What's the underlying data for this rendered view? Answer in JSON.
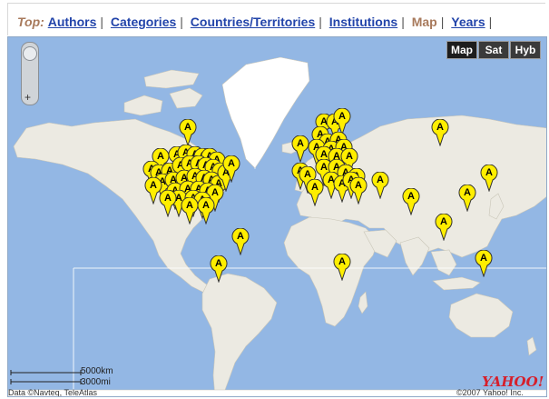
{
  "nav": {
    "heading": "Top:",
    "links": [
      {
        "label": "Authors",
        "current": false
      },
      {
        "label": "Categories",
        "current": false
      },
      {
        "label": "Countries/Territories",
        "current": false
      },
      {
        "label": "Institutions",
        "current": false
      },
      {
        "label": "Map",
        "current": true
      },
      {
        "label": "Years",
        "current": false
      }
    ],
    "separator": "|"
  },
  "map": {
    "map_types": [
      "Map",
      "Sat",
      "Hyb"
    ],
    "active_map_type": "Map",
    "zoom_minus": "−",
    "zoom_plus": "+",
    "marker_letter": "A",
    "marker_count": 72,
    "scale": {
      "km": "5000km",
      "mi": "3000mi"
    },
    "attribution": "Data ©Navteq, TeleAtlas",
    "copyright": "©2007 Yahoo! Inc.",
    "logo_text": "YAHOO!",
    "colors": {
      "water": "#93b7e4",
      "land": "#eceae2",
      "ice": "#ffffff",
      "marker": "#ffee00"
    }
  }
}
